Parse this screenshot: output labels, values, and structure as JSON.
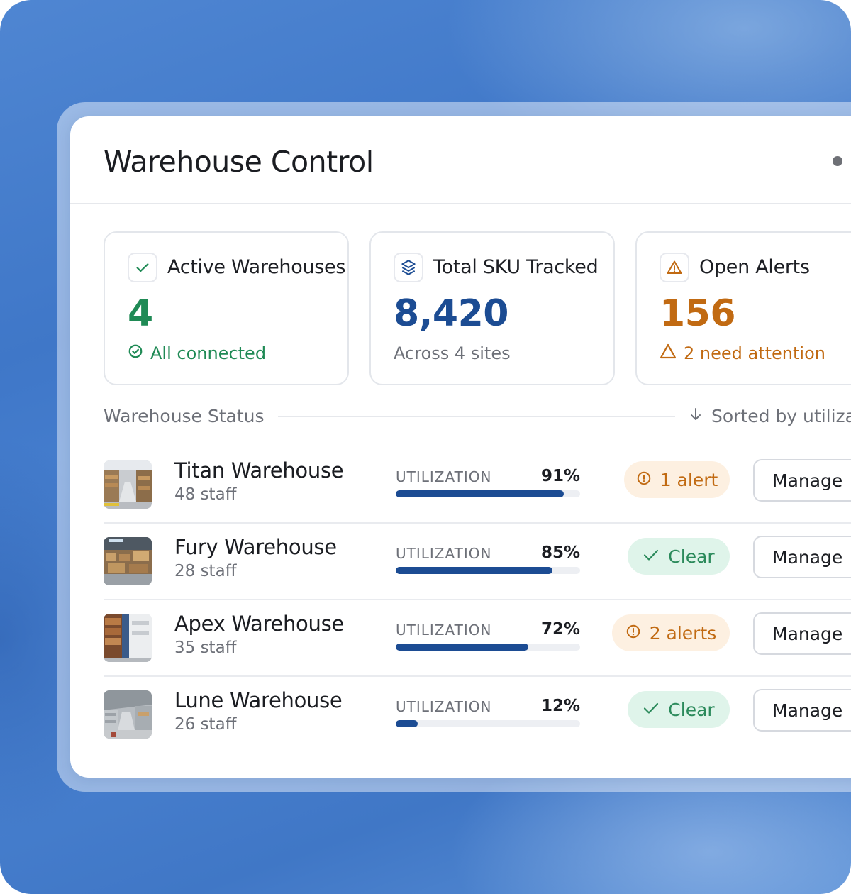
{
  "header": {
    "title": "Warehouse Control"
  },
  "stats": [
    {
      "label": "Active Warehouses",
      "value": "4",
      "sub": "All connected",
      "value_color": "#1f8a55",
      "sub_color": "#1f8a55"
    },
    {
      "label": "Total SKU Tracked",
      "value": "8,420",
      "sub": "Across 4 sites",
      "value_color": "#1c4c93",
      "sub_color": "#6d7078"
    },
    {
      "label": "Open Alerts",
      "value": "156",
      "sub": "2 need attention",
      "value_color": "#c16a12",
      "sub_color": "#c16a12"
    }
  ],
  "section": {
    "title": "Warehouse Status",
    "sort_label": "Sorted by utilizat"
  },
  "utilization_label": "UTILIZATION",
  "manage_label": "Manage",
  "warehouses": [
    {
      "name": "Titan Warehouse",
      "staff": "48 staff",
      "utilization": 91,
      "utilization_text": "91%",
      "status": "warn",
      "status_text": "1 alert",
      "status_icon": "alert-circle-icon"
    },
    {
      "name": "Fury Warehouse",
      "staff": "28 staff",
      "utilization": 85,
      "utilization_text": "85%",
      "status": "ok",
      "status_text": "Clear",
      "status_icon": "check-icon"
    },
    {
      "name": "Apex Warehouse",
      "staff": "35 staff",
      "utilization": 72,
      "utilization_text": "72%",
      "status": "warn",
      "status_text": "2 alerts",
      "status_icon": "alert-circle-icon"
    },
    {
      "name": "Lune Warehouse",
      "staff": "26 staff",
      "utilization": 12,
      "utilization_text": "12%",
      "status": "ok",
      "status_text": "Clear",
      "status_icon": "check-icon"
    }
  ],
  "colors": {
    "accent_blue": "#1c4c93",
    "success": "#1f8a55",
    "warning": "#c16a12"
  }
}
